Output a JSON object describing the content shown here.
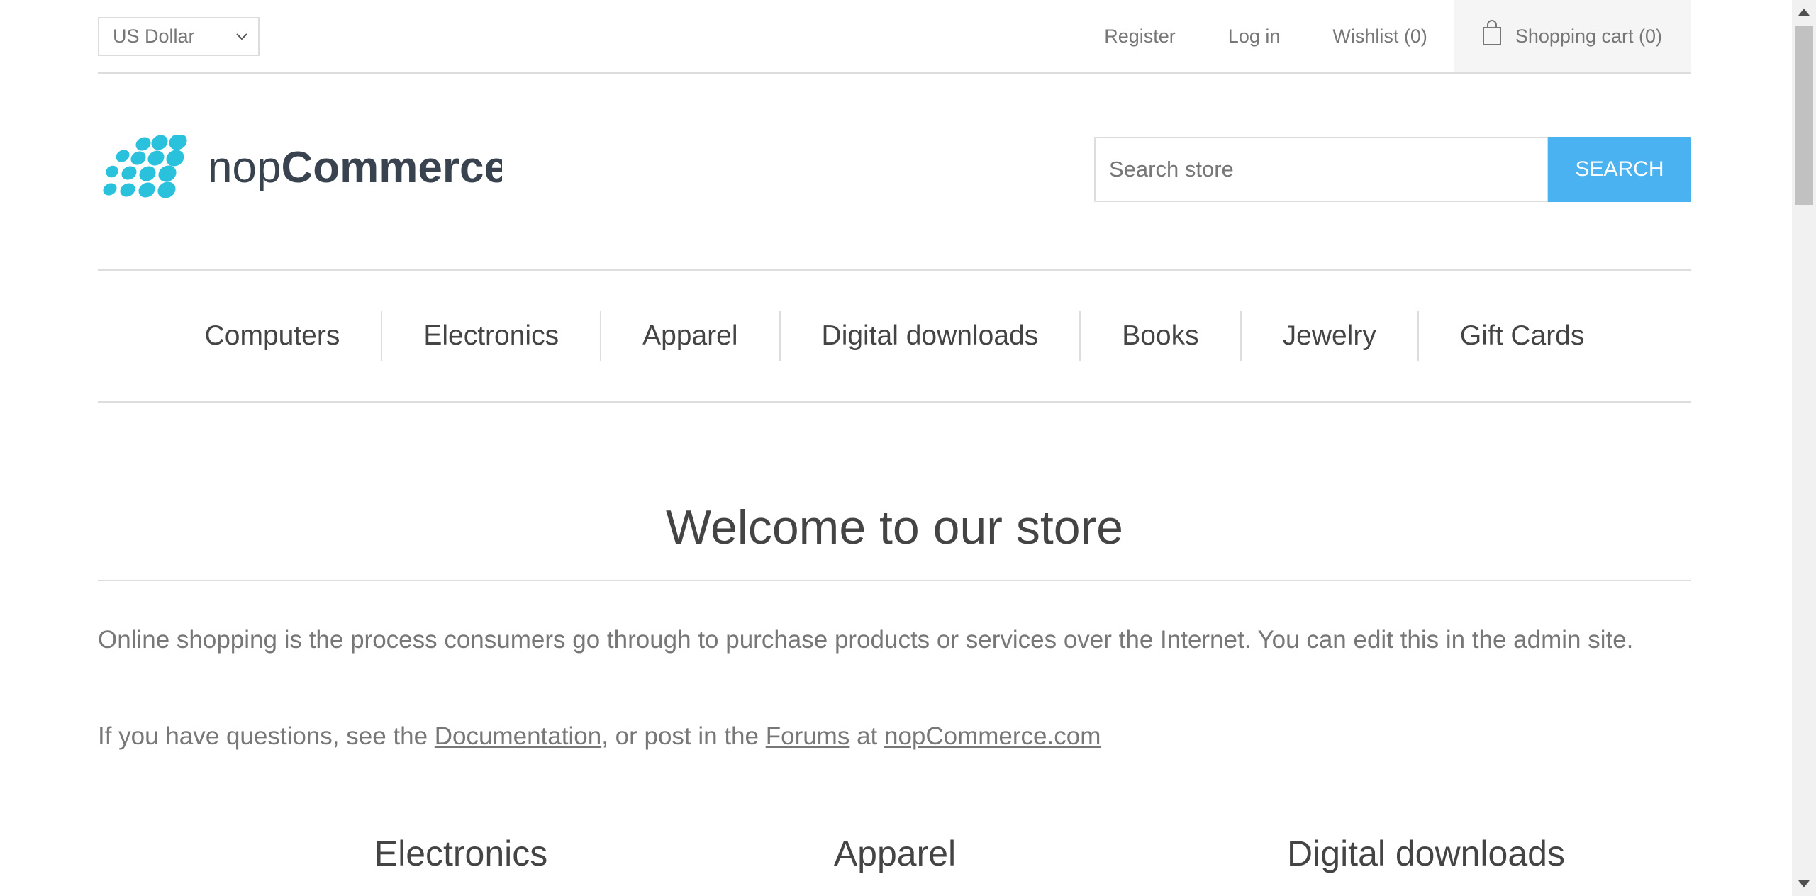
{
  "header": {
    "currency": "US Dollar",
    "links": {
      "register": "Register",
      "login": "Log in",
      "wishlist": "Wishlist (0)",
      "cart": "Shopping cart (0)"
    }
  },
  "logo": {
    "text_light": "nop",
    "text_bold": "Commerce"
  },
  "search": {
    "placeholder": "Search store",
    "button_label": "SEARCH"
  },
  "menu": {
    "items": [
      "Computers",
      "Electronics",
      "Apparel",
      "Digital downloads",
      "Books",
      "Jewelry",
      "Gift Cards"
    ]
  },
  "welcome": {
    "title": "Welcome to our store",
    "paragraph1": "Online shopping is the process consumers go through to purchase products or services over the Internet. You can edit this in the admin site.",
    "p2_prefix": "If you have questions, see the ",
    "p2_link1": "Documentation",
    "p2_mid1": ", or post in the ",
    "p2_link2": "Forums",
    "p2_mid2": " at ",
    "p2_link3": "nopCommerce.com"
  },
  "categories": {
    "items": [
      "Electronics",
      "Apparel",
      "Digital downloads"
    ]
  },
  "colors": {
    "accent": "#4ab2f1",
    "logo_dots": "#29c1dc",
    "text": "#444444",
    "muted": "#777777",
    "border": "#dddddd"
  }
}
